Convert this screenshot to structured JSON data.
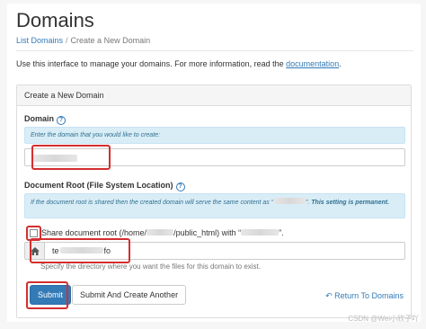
{
  "header": {
    "title": "Domains"
  },
  "breadcrumb": {
    "link": "List Domains",
    "separator": "/",
    "current": "Create a New Domain"
  },
  "intro": {
    "text": "Use this interface to manage your domains. For more information, read the ",
    "link": "documentation",
    "tail": "."
  },
  "panel": {
    "heading": "Create a New Domain"
  },
  "domain": {
    "label": "Domain",
    "info": "Enter the domain that you would like to create:",
    "value": ""
  },
  "docroot": {
    "label": "Document Root (File System Location)",
    "info_pre": "If the document root is shared then the created domain will serve the same content as “",
    "info_post": "”. ",
    "info_bold": "This setting is permanent.",
    "share_label_pre": "Share document root (/home/",
    "share_label_mid": "/public_html) with “",
    "share_label_post": "”.",
    "value_start": "te",
    "value_end": "fo",
    "hint": "Specify the directory where you want the files for this domain to exist."
  },
  "actions": {
    "submit": "Submit",
    "submit_another": "Submit And Create Another",
    "return": "Return To Domains"
  },
  "watermark": "CSDN @Wei小欣子吖",
  "icons": {
    "help": "help-circle-icon",
    "home": "home-icon",
    "return": "return-arrow-icon"
  },
  "colors": {
    "accent": "#337ab7",
    "info_bg": "#d9edf7",
    "highlight": "#d32f2f"
  }
}
